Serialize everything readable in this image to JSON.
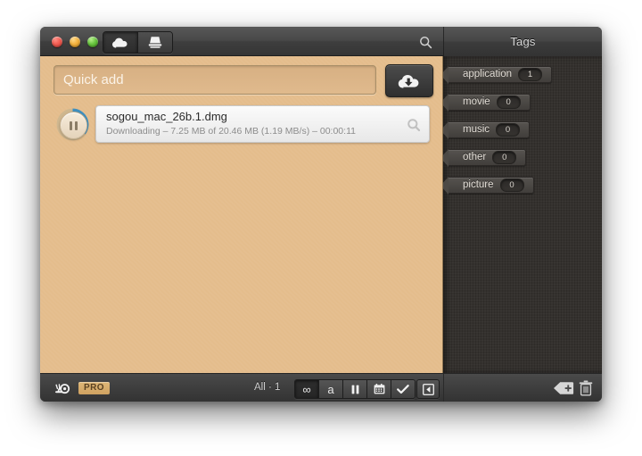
{
  "window": {
    "traffic_lights": [
      "close",
      "minimize",
      "zoom"
    ],
    "view_switch": [
      {
        "name": "downloads-view",
        "icon": "cloud-download-icon",
        "active": true
      },
      {
        "name": "completed-view",
        "icon": "tray-inbox-icon",
        "active": false
      }
    ],
    "search_icon": "search-icon",
    "tags_title": "Tags"
  },
  "main": {
    "quick_add": {
      "placeholder": "Quick add",
      "value": "",
      "button_icon": "cloud-download-icon"
    },
    "downloads": [
      {
        "name": "sogou_mac_26b.1.dmg",
        "status": "Downloading – 7.25 MB of 20.46 MB (1.19 MB/s) – 00:00:11",
        "state": "downloading",
        "progress_percent": 35,
        "control_icon": "pause-icon",
        "reveal_icon": "search-icon"
      }
    ]
  },
  "tags": {
    "title": "Tags",
    "items": [
      {
        "label": "application",
        "count": "1"
      },
      {
        "label": "movie",
        "count": "0"
      },
      {
        "label": "music",
        "count": "0"
      },
      {
        "label": "other",
        "count": "0"
      },
      {
        "label": "picture",
        "count": "0"
      }
    ]
  },
  "bottom_bar": {
    "speed_limit_icon": "snail-icon",
    "pro_badge": "PRO",
    "filter_count": "All · 1",
    "filters": [
      {
        "name": "filter-all",
        "icon": "infinity-icon",
        "glyph": "∞",
        "active": true
      },
      {
        "name": "filter-active",
        "icon": "letter-a-icon",
        "glyph": "a",
        "active": false
      },
      {
        "name": "filter-paused",
        "icon": "pause-icon",
        "glyph": "",
        "active": false
      },
      {
        "name": "filter-scheduled",
        "icon": "calendar-icon",
        "glyph": "",
        "active": false
      },
      {
        "name": "filter-completed",
        "icon": "checkmark-icon",
        "glyph": "",
        "active": false
      }
    ],
    "sidebar_toggle_icon": "panel-collapse-icon",
    "add_tag_icon": "add-tag-icon",
    "delete_icon": "trash-icon"
  },
  "colors": {
    "content_bg": "#e4bd8c",
    "tags_bg": "#34312e",
    "chrome": "#3e3e3e",
    "progress_accent": "#3f8fbf",
    "pro_badge": "#cfa261"
  }
}
